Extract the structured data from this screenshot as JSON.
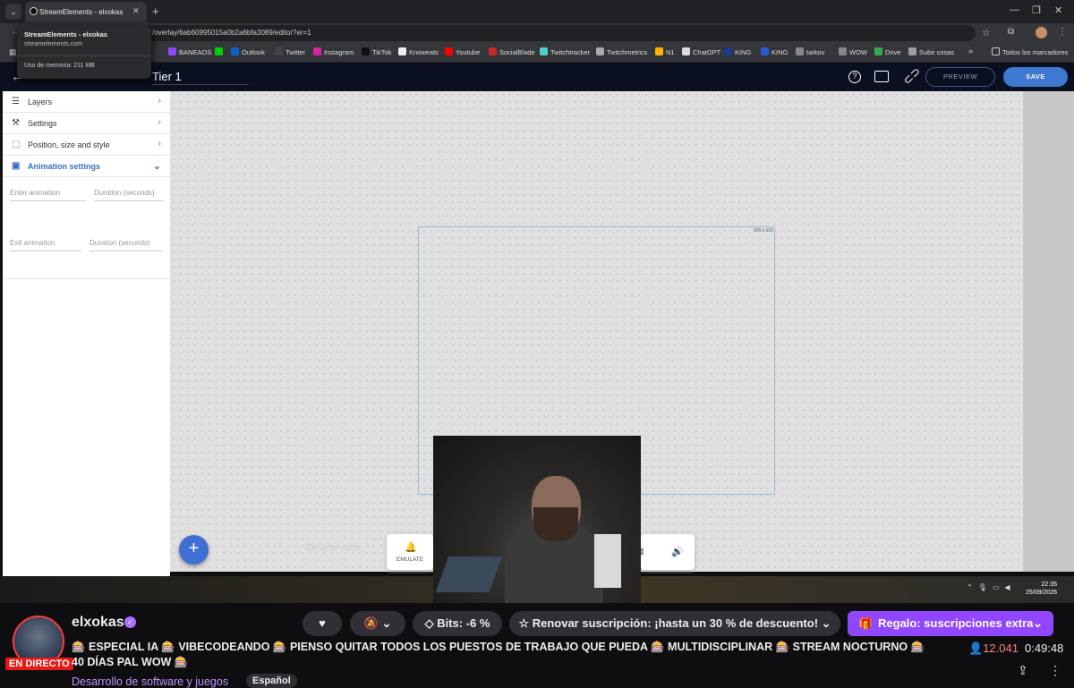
{
  "browser": {
    "tab_title": "StreamElements - elxokas",
    "url": "/overlay/6ab60995015a0b2a6bfa3089/editor?er=1",
    "popup": {
      "title": "StreamElements - elxokas",
      "domain": "streamelements.com",
      "memory": "Uso de memoria: 211 MB"
    },
    "bookmarks": [
      {
        "label": "BANEAOS",
        "color": "#9147ff"
      },
      {
        "label": "",
        "color": "#00d000"
      },
      {
        "label": "Outlook",
        "color": "#0a64c8"
      },
      {
        "label": "Twitter",
        "color": "#444444"
      },
      {
        "label": "Instagram",
        "color": "#d6249f"
      },
      {
        "label": "TikTok",
        "color": "#111111"
      },
      {
        "label": "Knoweats",
        "color": "#eeeeee"
      },
      {
        "label": "Youtube",
        "color": "#ff0000"
      },
      {
        "label": "SocialBlade",
        "color": "#c62828"
      },
      {
        "label": "Twitchtracker",
        "color": "#4dd0c6"
      },
      {
        "label": "Twitchmetrics",
        "color": "#aaaaaa"
      },
      {
        "label": "N1",
        "color": "#ffb300"
      },
      {
        "label": "ChatGPT",
        "color": "#dddddd"
      },
      {
        "label": "KING",
        "color": "#1e3a8a"
      },
      {
        "label": "KING",
        "color": "#2a5ad8"
      },
      {
        "label": "tarkov",
        "color": "#888888"
      },
      {
        "label": "WOW",
        "color": "#888888"
      },
      {
        "label": "Drive",
        "color": "#34a853"
      },
      {
        "label": "Subir cosas",
        "color": "#9e9e9e"
      }
    ],
    "all_bookmarks": "Todos los marcadores"
  },
  "editor": {
    "overlay_title": "Tier 1",
    "preview_label": "PREVIEW",
    "save_label": "SAVE",
    "sidebar": [
      {
        "label": "Layers",
        "icon": "layers-icon",
        "glyph": "☰"
      },
      {
        "label": "Settings",
        "icon": "wrench-icon",
        "glyph": "🔧"
      },
      {
        "label": "Position, size and style",
        "icon": "resize-icon",
        "glyph": "⬚"
      },
      {
        "label": "Animation settings",
        "icon": "animation-icon",
        "glyph": "▣"
      }
    ],
    "enter_animation": "Enter animation",
    "enter_duration": "Duration (seconds)",
    "exit_animation": "Exit animation",
    "exit_duration": "Duration (seconds)",
    "frame_size": "900 x 600",
    "delete_hint": "Delete with",
    "emulate_label": "EMULATE"
  },
  "taskbar": {
    "time": "22:35",
    "date": "25/09/2026"
  },
  "twitch": {
    "channel": "elxokas",
    "live_label": "EN DIRECTO",
    "bits_label": "Bits: -6 %",
    "resub_label": "Renovar suscripción: ¡hasta un 30 % de descuento!",
    "gift_label": "Regalo: suscripciones extra",
    "stream_title": "🎰 ESPECIAL IA 🎰 VIBECODEANDO 🎰 PIENSO QUITAR TODOS LOS PUESTOS DE TRABAJO QUE PUEDA 🎰 MULTIDISCIPLINAR 🎰 STREAM NOCTURNO 🎰 40 DÍAS PAL WOW 🎰",
    "category": "Desarrollo de software y juegos",
    "tag": "Español",
    "viewers": "12.041",
    "uptime": "0:49:48"
  }
}
